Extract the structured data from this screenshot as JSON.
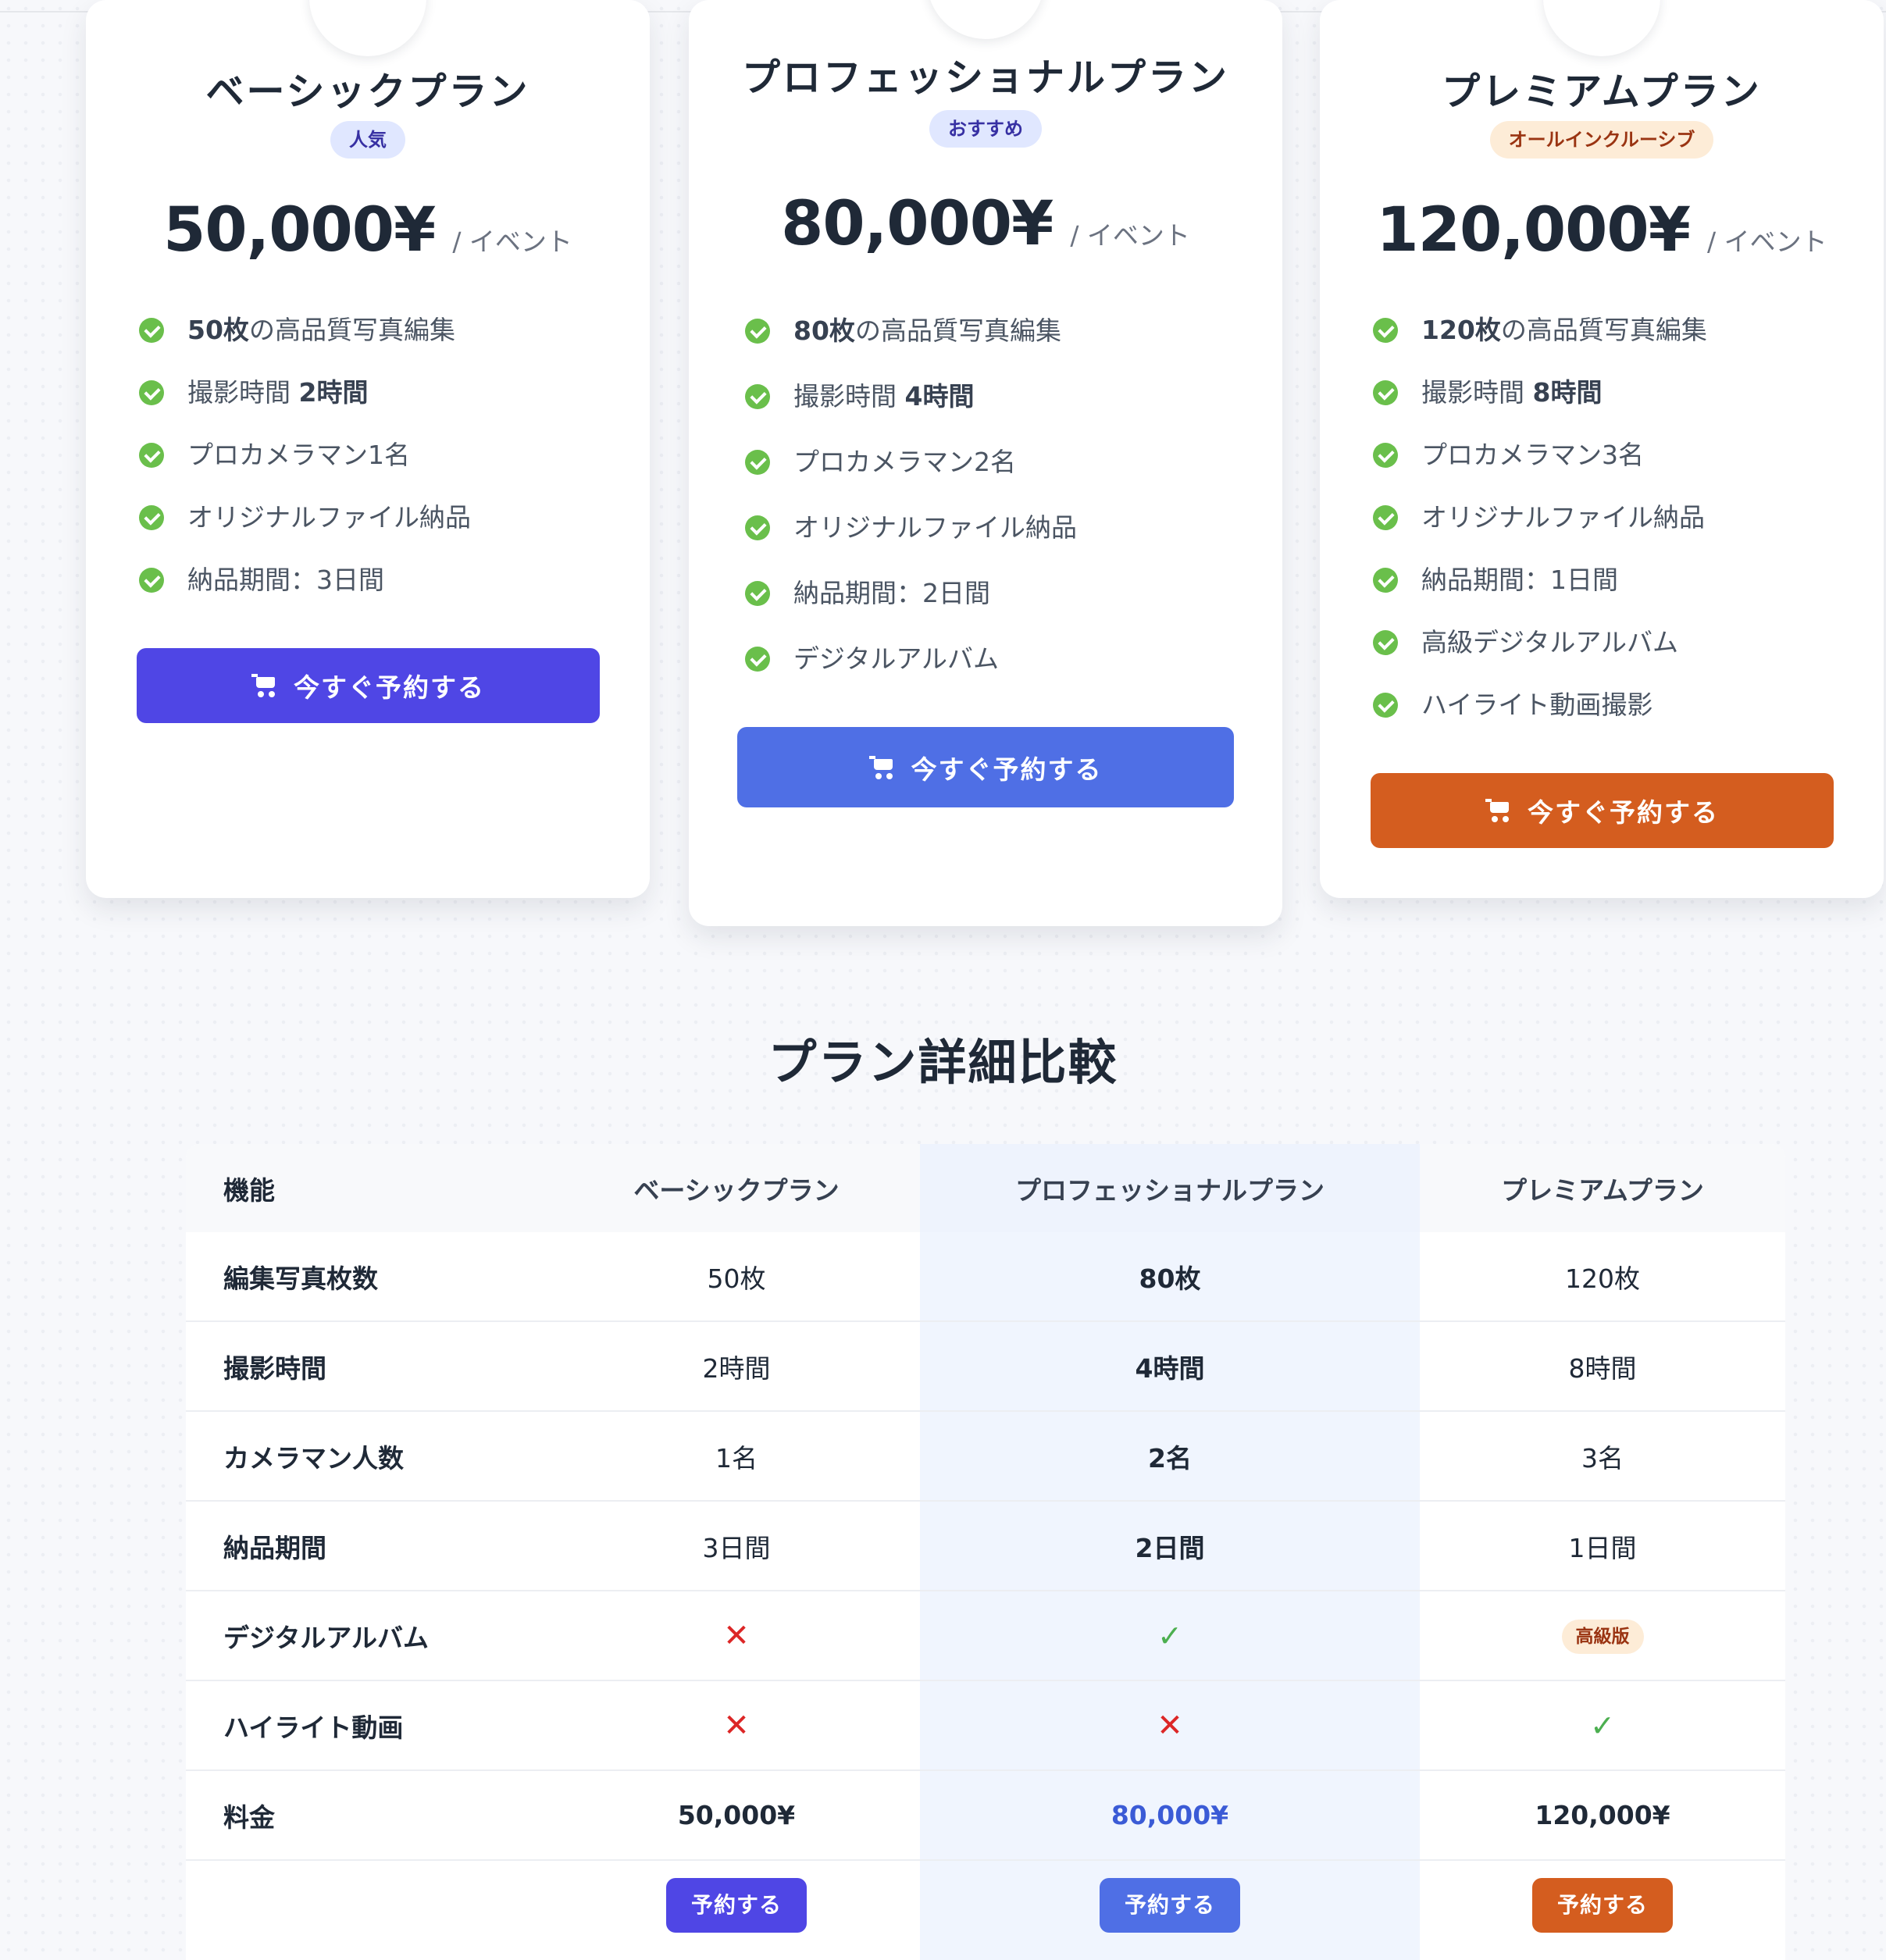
{
  "plans": [
    {
      "title": "ベーシックプラン",
      "badge": "人気",
      "price": "50,000¥",
      "per": "/ イベント",
      "features": [
        {
          "pre": "",
          "bold": "50枚",
          "post": "の高品質写真編集"
        },
        {
          "pre": "撮影時間 ",
          "bold": "2時間",
          "post": ""
        },
        {
          "pre": "プロカメラマン1名",
          "bold": "",
          "post": ""
        },
        {
          "pre": "オリジナルファイル納品",
          "bold": "",
          "post": ""
        },
        {
          "pre": "納品期間：3日間",
          "bold": "",
          "post": ""
        }
      ],
      "cta": "今すぐ予約する"
    },
    {
      "title": "プロフェッショナルプラン",
      "badge": "おすすめ",
      "price": "80,000¥",
      "per": "/ イベント",
      "features": [
        {
          "pre": "",
          "bold": "80枚",
          "post": "の高品質写真編集"
        },
        {
          "pre": "撮影時間 ",
          "bold": "4時間",
          "post": ""
        },
        {
          "pre": "プロカメラマン2名",
          "bold": "",
          "post": ""
        },
        {
          "pre": "オリジナルファイル納品",
          "bold": "",
          "post": ""
        },
        {
          "pre": "納品期間：2日間",
          "bold": "",
          "post": ""
        },
        {
          "pre": "デジタルアルバム",
          "bold": "",
          "post": ""
        }
      ],
      "cta": "今すぐ予約する"
    },
    {
      "title": "プレミアムプラン",
      "badge": "オールインクルーシブ",
      "price": "120,000¥",
      "per": "/ イベント",
      "features": [
        {
          "pre": "",
          "bold": "120枚",
          "post": "の高品質写真編集"
        },
        {
          "pre": "撮影時間 ",
          "bold": "8時間",
          "post": ""
        },
        {
          "pre": "プロカメラマン3名",
          "bold": "",
          "post": ""
        },
        {
          "pre": "オリジナルファイル納品",
          "bold": "",
          "post": ""
        },
        {
          "pre": "納品期間：1日間",
          "bold": "",
          "post": ""
        },
        {
          "pre": "高級デジタルアルバム",
          "bold": "",
          "post": ""
        },
        {
          "pre": "ハイライト動画撮影",
          "bold": "",
          "post": ""
        }
      ],
      "cta": "今すぐ予約する"
    }
  ],
  "comparison": {
    "title": "プラン詳細比較",
    "headers": [
      "機能",
      "ベーシックプラン",
      "プロフェッショナルプラン",
      "プレミアムプラン"
    ],
    "rows": [
      {
        "feature": "編集写真枚数",
        "values": [
          "50枚",
          "80枚",
          "120枚"
        ]
      },
      {
        "feature": "撮影時間",
        "values": [
          "2時間",
          "4時間",
          "8時間"
        ]
      },
      {
        "feature": "カメラマン人数",
        "values": [
          "1名",
          "2名",
          "3名"
        ]
      },
      {
        "feature": "納品期間",
        "values": [
          "3日間",
          "2日間",
          "1日間"
        ]
      },
      {
        "feature": "デジタルアルバム",
        "values": [
          "✕",
          "✓",
          "高級版"
        ]
      },
      {
        "feature": "ハイライト動画",
        "values": [
          "✕",
          "✕",
          "✓"
        ]
      },
      {
        "feature": "料金",
        "values": [
          "50,000¥",
          "80,000¥",
          "120,000¥"
        ]
      }
    ],
    "book_label": "予約する"
  },
  "icons": {
    "feature_check": "check-circle-icon",
    "cta": "cart-icon",
    "not_included": "x-mark-icon",
    "included": "checkmark-icon"
  },
  "colors": {
    "basic_accent": "#4f46e5",
    "professional_accent": "#4f6fe5",
    "premium_accent": "#d45d1f",
    "check_green": "#6abf4b",
    "cross_red": "#dc2626",
    "professional_column_bg": "#f0f5fe"
  }
}
